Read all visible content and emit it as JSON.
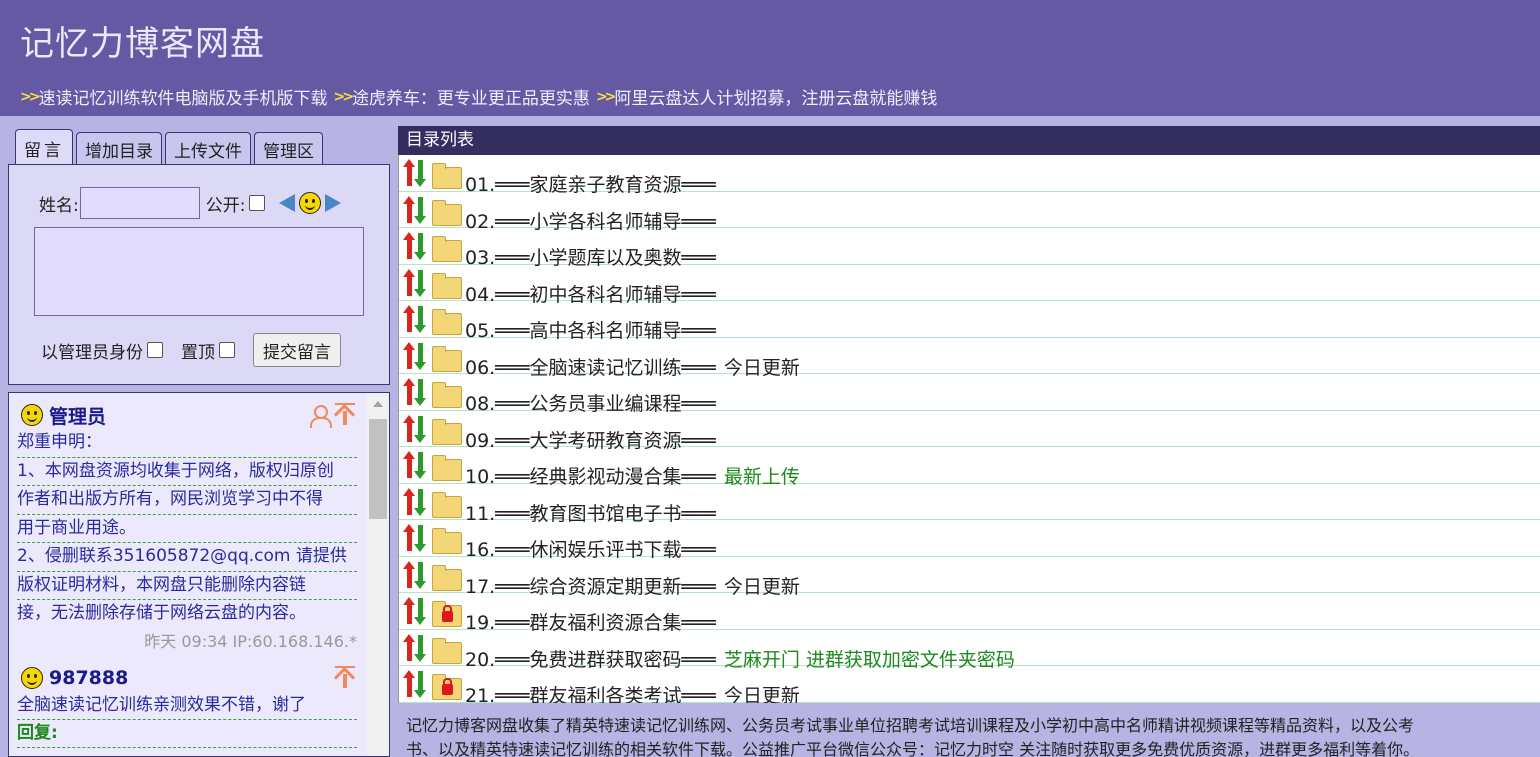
{
  "site": {
    "title": "记忆力博客网盘",
    "links": [
      {
        "label": "速读记忆训练软件电脑版及手机版下载"
      },
      {
        "label": "途虎养车：更专业更正品更实惠"
      },
      {
        "label": "阿里云盘达人计划招募，注册云盘就能赚钱"
      }
    ]
  },
  "tabs": [
    {
      "label": "留言",
      "active": true
    },
    {
      "label": "增加目录",
      "active": false
    },
    {
      "label": "上传文件",
      "active": false
    },
    {
      "label": "管理区",
      "active": false
    }
  ],
  "form": {
    "name_label": "姓名:",
    "name_value": "",
    "public_label": "公开:",
    "message_value": "",
    "as_admin_label": "以管理员身份",
    "pin_label": "置顶",
    "submit_label": "提交留言"
  },
  "comments": [
    {
      "author": "管理员",
      "lines": [
        "郑重申明：",
        "1、本网盘资源均收集于网络，版权归原创",
        "作者和出版方所有，网民浏览学习中不得",
        "用于商业用途。",
        "2、侵删联系351605872@qq.com 请提供",
        "版权证明材料，本网盘只能删除内容链",
        "接，无法删除存储于网络云盘的内容。"
      ],
      "meta": "昨天 09:34 IP:60.168.146.*"
    },
    {
      "author": "987888",
      "lines": [
        "全脑速读记忆训练亲测效果不错，谢了"
      ],
      "reply_label": "回复:"
    }
  ],
  "directory": {
    "header": "目录列表",
    "items": [
      {
        "name": "01.═══家庭亲子教育资源═══",
        "tag": "",
        "tag_color": "",
        "locked": false
      },
      {
        "name": "02.═══小学各科名师辅导═══",
        "tag": "",
        "tag_color": "",
        "locked": false
      },
      {
        "name": "03.═══小学题库以及奥数═══",
        "tag": "",
        "tag_color": "",
        "locked": false
      },
      {
        "name": "04.═══初中各科名师辅导═══",
        "tag": "",
        "tag_color": "",
        "locked": false
      },
      {
        "name": "05.═══高中各科名师辅导═══",
        "tag": "",
        "tag_color": "",
        "locked": false
      },
      {
        "name": "06.═══全脑速读记忆训练═══",
        "tag": "今日更新",
        "tag_color": "black",
        "locked": false
      },
      {
        "name": "08.═══公务员事业编课程═══",
        "tag": "",
        "tag_color": "",
        "locked": false
      },
      {
        "name": "09.═══大学考研教育资源═══",
        "tag": "",
        "tag_color": "",
        "locked": false
      },
      {
        "name": "10.═══经典影视动漫合集═══",
        "tag": "最新上传",
        "tag_color": "green",
        "locked": false
      },
      {
        "name": "11.═══教育图书馆电子书═══",
        "tag": "",
        "tag_color": "",
        "locked": false
      },
      {
        "name": "16.═══休闲娱乐评书下载═══",
        "tag": "",
        "tag_color": "",
        "locked": false
      },
      {
        "name": "17.═══综合资源定期更新═══",
        "tag": "今日更新",
        "tag_color": "black",
        "locked": false
      },
      {
        "name": "19.═══群友福利资源合集═══",
        "tag": "",
        "tag_color": "",
        "locked": true
      },
      {
        "name": "20.═══免费进群获取密码═══",
        "tag": "芝麻开门 进群获取加密文件夹密码",
        "tag_color": "green",
        "locked": false
      },
      {
        "name": "21.═══群友福利各类考试═══",
        "tag": "今日更新",
        "tag_color": "black",
        "locked": true
      }
    ]
  },
  "footer": {
    "line1": "记忆力博客网盘收集了精英特速读记忆训练网、公务员考试事业单位招聘考试培训课程及小学初中高中名师精讲视频课程等精品资料，以及公考",
    "line2": "书、以及精英特速读记忆训练的相关软件下载。公益推广平台微信公众号：记忆力时空 关注随时获取更多免费优质资源，进群更多福利等着你。"
  },
  "colors": {
    "header_bg": "#6559a3",
    "page_bg": "#b7b3e2",
    "dir_header_bg": "#332e5f",
    "tag_green": "#1c8a1c"
  }
}
